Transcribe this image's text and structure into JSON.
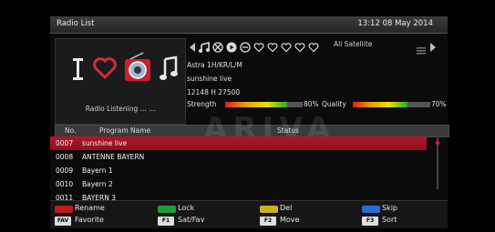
{
  "header": {
    "title": "Radio List",
    "clock": "13:12 08 May 2014"
  },
  "mode_panel": {
    "status": "Radio  Listening ... ...",
    "icons": [
      "tv-icon",
      "favorite-heart-icon",
      "radio-icon",
      "music-note-icon"
    ]
  },
  "nav_bar": {
    "satellite": "All Satellite",
    "icons": [
      "prev-arrow-icon",
      "music-icon",
      "scramble-icon",
      "play-icon",
      "lock-icon",
      "heart-icon",
      "heart-icon",
      "heart-icon",
      "heart-icon",
      "list-icon",
      "next-arrow-icon"
    ]
  },
  "channel_info": {
    "satellite": "Astra 1H/KR/L/M",
    "program": "sunshine live",
    "transponder": "12148 H 27500"
  },
  "signal": {
    "strength_label": "Strength",
    "strength_value": "80%",
    "strength_level": 0.8,
    "quality_label": "Quality",
    "quality_value": "70%",
    "quality_level": 0.7
  },
  "table": {
    "headers": {
      "no": "No.",
      "name": "Program Name",
      "status": "Status"
    },
    "rows": [
      {
        "no": "0007",
        "name": "sunshine live",
        "selected": true
      },
      {
        "no": "0008",
        "name": "ANTENNE BAYERN",
        "selected": false
      },
      {
        "no": "0009",
        "name": "Bayern 1",
        "selected": false
      },
      {
        "no": "0010",
        "name": "Bayern 2",
        "selected": false
      },
      {
        "no": "0011",
        "name": "BAYERN 3",
        "selected": false
      }
    ]
  },
  "watermark": "ARIVA",
  "footer": {
    "color_keys": [
      {
        "label": "Rename",
        "color": "#c21a1a"
      },
      {
        "label": "Lock",
        "color": "#1d9d3a"
      },
      {
        "label": "Del",
        "color": "#c9b21c"
      },
      {
        "label": "Skip",
        "color": "#2a6cd4"
      }
    ],
    "function_keys": [
      {
        "key": "FAV",
        "label": "Favorite"
      },
      {
        "key": "F1",
        "label": "Sat/Fav"
      },
      {
        "key": "F2",
        "label": "Move"
      },
      {
        "key": "F3",
        "label": "Sort"
      }
    ]
  }
}
